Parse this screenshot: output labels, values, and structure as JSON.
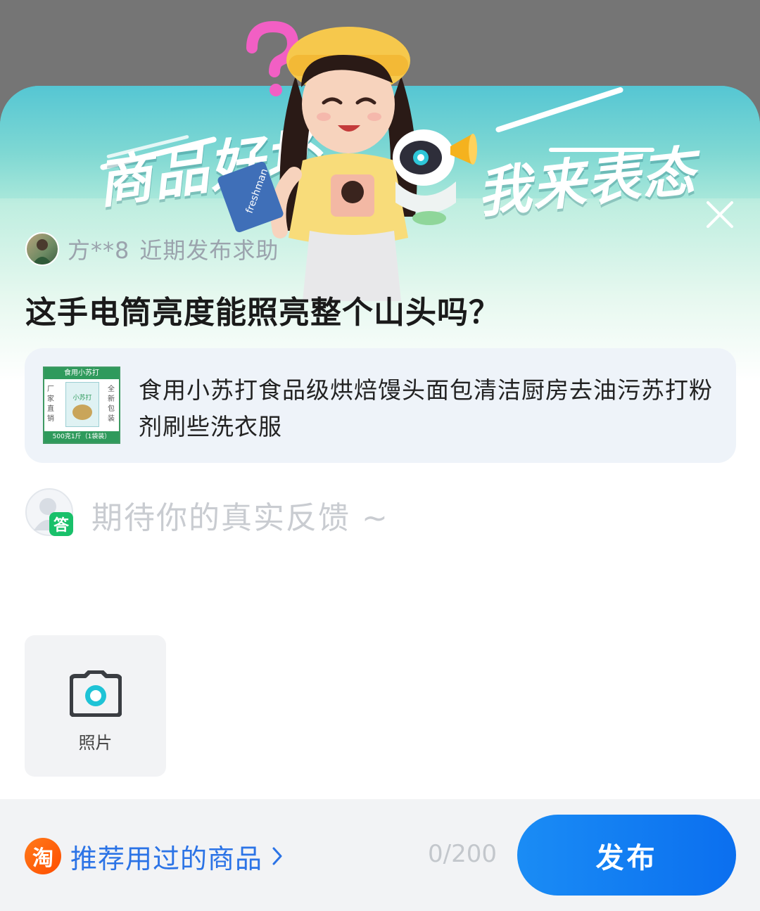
{
  "banner": {
    "slogan_left": "商品好坏",
    "slogan_right": "我来表态",
    "book_text": "freshman",
    "close_icon": "close-icon"
  },
  "asker": {
    "name": "方**8",
    "action": "近期发布求助"
  },
  "question": "这手电筒亮度能照亮整个山头吗？",
  "product": {
    "title": "食用小苏打食品级烘焙馒头面包清洁厨房去油污苏打粉剂刷些洗衣服",
    "thumb_header": "食用小苏打",
    "thumb_brand": "小苏打",
    "thumb_left_label": "厂家直销",
    "thumb_right_label": "全新包装",
    "thumb_footer": "500克1斤（1袋装）"
  },
  "answer": {
    "badge": "答",
    "placeholder": "期待你的真实反馈 ~"
  },
  "photo": {
    "icon": "camera-icon",
    "label": "照片"
  },
  "footer": {
    "taobao_glyph": "淘",
    "recommend_label": "推荐用过的商品",
    "char_count": "0/200",
    "publish_label": "发布"
  },
  "colors": {
    "accent_blue": "#0b6fef",
    "link_blue": "#2b73e6",
    "badge_green": "#19c06a",
    "taobao_orange": "#ff5a00",
    "banner_teal": "#55c6d3"
  }
}
